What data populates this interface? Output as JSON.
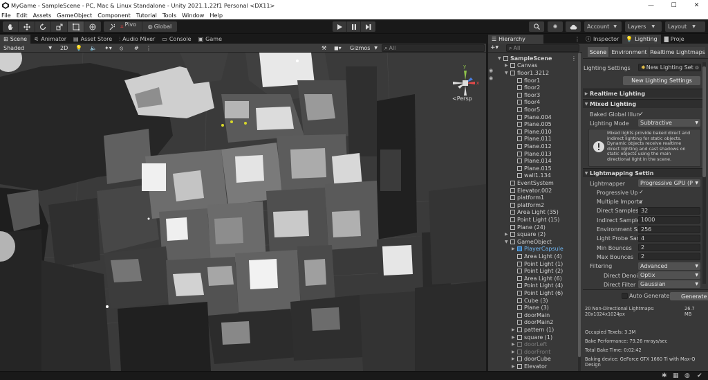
{
  "window": {
    "title": "MyGame - SampleScene - PC, Mac & Linux Standalone - Unity 2021.1.22f1 Personal <DX11>"
  },
  "menu": [
    "File",
    "Edit",
    "Assets",
    "GameObject",
    "Component",
    "Tutorial",
    "Tools",
    "Window",
    "Help"
  ],
  "toolbar": {
    "pivot_label": "Pivo",
    "global_label": "Global",
    "account_label": "Account",
    "layers_label": "Layers",
    "layout_label": "Layout"
  },
  "scene_tabs": [
    "Scene",
    "Animator",
    "Asset Store",
    "Audio Mixer",
    "Console",
    "Game"
  ],
  "scene_bar": {
    "shading": "Shaded",
    "mode2d": "2D",
    "gizmos": "Gizmos",
    "search_placeholder": "All"
  },
  "gizmo": {
    "persp_label": "<Persp",
    "x": "x",
    "y": "y"
  },
  "hierarchy": {
    "tab_label": "Hierarchy",
    "search_placeholder": "All",
    "items": [
      {
        "label": "SampleScene",
        "depth": 0,
        "arrow": "▼",
        "selected": false
      },
      {
        "label": "Canvas",
        "depth": 1,
        "arrow": "▶",
        "selected": false
      },
      {
        "label": "floor1.3212",
        "depth": 1,
        "arrow": "▼",
        "selected": false
      },
      {
        "label": "floor1",
        "depth": 2,
        "arrow": "",
        "selected": false
      },
      {
        "label": "floor2",
        "depth": 2,
        "arrow": "",
        "selected": false
      },
      {
        "label": "floor3",
        "depth": 2,
        "arrow": "",
        "selected": false
      },
      {
        "label": "floor4",
        "depth": 2,
        "arrow": "",
        "selected": false
      },
      {
        "label": "floor5",
        "depth": 2,
        "arrow": "",
        "selected": false
      },
      {
        "label": "Plane.004",
        "depth": 2,
        "arrow": "",
        "selected": false
      },
      {
        "label": "Plane.005",
        "depth": 2,
        "arrow": "",
        "selected": false
      },
      {
        "label": "Plane.010",
        "depth": 2,
        "arrow": "",
        "selected": false
      },
      {
        "label": "Plane.011",
        "depth": 2,
        "arrow": "",
        "selected": false
      },
      {
        "label": "Plane.012",
        "depth": 2,
        "arrow": "",
        "selected": false
      },
      {
        "label": "Plane.013",
        "depth": 2,
        "arrow": "",
        "selected": false
      },
      {
        "label": "Plane.014",
        "depth": 2,
        "arrow": "",
        "selected": false
      },
      {
        "label": "Plane.015",
        "depth": 2,
        "arrow": "",
        "selected": false
      },
      {
        "label": "wall1.134",
        "depth": 2,
        "arrow": "",
        "selected": false
      },
      {
        "label": "EventSystem",
        "depth": 1,
        "arrow": "",
        "selected": false
      },
      {
        "label": "Elevator.002",
        "depth": 1,
        "arrow": "",
        "selected": false
      },
      {
        "label": "platform1",
        "depth": 1,
        "arrow": "",
        "selected": false
      },
      {
        "label": "platform2",
        "depth": 1,
        "arrow": "",
        "selected": false
      },
      {
        "label": "Area Light (35)",
        "depth": 1,
        "arrow": "",
        "selected": false
      },
      {
        "label": "Point Light (15)",
        "depth": 1,
        "arrow": "",
        "selected": false
      },
      {
        "label": "Plane (24)",
        "depth": 1,
        "arrow": "",
        "selected": false
      },
      {
        "label": "square (2)",
        "depth": 1,
        "arrow": "▶",
        "selected": false
      },
      {
        "label": "GameObject",
        "depth": 1,
        "arrow": "▼",
        "selected": false
      },
      {
        "label": "PlayerCapsule",
        "depth": 2,
        "arrow": "▶",
        "selected": false,
        "blue": true
      },
      {
        "label": "Area Light (4)",
        "depth": 2,
        "arrow": "",
        "selected": false
      },
      {
        "label": "Point Light (1)",
        "depth": 2,
        "arrow": "",
        "selected": false
      },
      {
        "label": "Point Light (2)",
        "depth": 2,
        "arrow": "",
        "selected": false
      },
      {
        "label": "Area Light (6)",
        "depth": 2,
        "arrow": "",
        "selected": false
      },
      {
        "label": "Point Light (4)",
        "depth": 2,
        "arrow": "",
        "selected": false
      },
      {
        "label": "Point Light (6)",
        "depth": 2,
        "arrow": "",
        "selected": false
      },
      {
        "label": "Cube (3)",
        "depth": 2,
        "arrow": "",
        "selected": false
      },
      {
        "label": "Plane (3)",
        "depth": 2,
        "arrow": "",
        "selected": false
      },
      {
        "label": "doorMain",
        "depth": 2,
        "arrow": "",
        "selected": false
      },
      {
        "label": "doorMain2",
        "depth": 2,
        "arrow": "",
        "selected": false
      },
      {
        "label": "pattern (1)",
        "depth": 2,
        "arrow": "▶",
        "selected": false
      },
      {
        "label": "square (1)",
        "depth": 2,
        "arrow": "▶",
        "selected": false
      },
      {
        "label": "doorLeft",
        "depth": 2,
        "arrow": "▶",
        "selected": false,
        "dim": true
      },
      {
        "label": "doorFront",
        "depth": 2,
        "arrow": "▶",
        "selected": false,
        "dim": true
      },
      {
        "label": "doorCube",
        "depth": 2,
        "arrow": "▶",
        "selected": false
      },
      {
        "label": "Elevator",
        "depth": 2,
        "arrow": "▶",
        "selected": false
      }
    ]
  },
  "inspector": {
    "tabs": [
      "Inspector",
      "Lighting",
      "Proje"
    ],
    "subtabs": [
      "Scene",
      "Environment",
      "Realtime Lightmaps"
    ],
    "lighting_settings_label": "Lighting Settings",
    "lighting_settings_value": "New Lighting Set",
    "new_settings_button": "New Lighting Settings",
    "realtime_section": "Realtime Lighting",
    "mixed_section": "Mixed Lighting",
    "baked_gi_label": "Baked Global Illun",
    "lighting_mode_label": "Lighting Mode",
    "lighting_mode_value": "Subtractive",
    "info_text": [
      "Mixed lights provide baked direct and",
      "indirect lighting for static objects.",
      "Dynamic objects receive realtime",
      "direct lighting and cast shadows on",
      "static objects using the main",
      "directional light in the scene."
    ],
    "lightmapping_section": "Lightmapping Settin",
    "rows": [
      {
        "label": "Lightmapper",
        "kind": "drop",
        "value": "Progressive GPU (P"
      },
      {
        "label": "Progressive Up",
        "kind": "check",
        "value": "✓"
      },
      {
        "label": "Multiple Importa",
        "kind": "check",
        "value": "✓"
      },
      {
        "label": "Direct Samples",
        "kind": "field",
        "value": "32"
      },
      {
        "label": "Indirect Sample",
        "kind": "field",
        "value": "1000"
      },
      {
        "label": "Environment Sa",
        "kind": "field",
        "value": "256"
      },
      {
        "label": "Light Probe Sar",
        "kind": "field",
        "value": "4"
      },
      {
        "label": "Min Bounces",
        "kind": "field",
        "value": "2"
      },
      {
        "label": "Max Bounces",
        "kind": "field",
        "value": "2"
      },
      {
        "label": "Filtering",
        "kind": "drop",
        "value": "Advanced"
      },
      {
        "label": "Direct Denois",
        "kind": "drop",
        "value": "Optix"
      },
      {
        "label": "Direct Filter",
        "kind": "drop",
        "value": "Gaussian"
      }
    ],
    "auto_generate_label": "Auto Generate",
    "generate_button": "Generate",
    "stats": {
      "lightmaps_line1": "20 Non-Directional Lightmaps:",
      "lightmaps_line2": "20x1024x1024px",
      "size_value": "26.7",
      "size_unit": "MB",
      "occupied": "Occupied Texels: 3.3M",
      "performance": "Bake Performance: 79.26 mrays/sec",
      "total_time": "Total Bake Time: 0:02:42",
      "device_line1": "Baking device: GeForce GTX 1660 Ti with Max-Q",
      "device_line2": "Design"
    }
  }
}
